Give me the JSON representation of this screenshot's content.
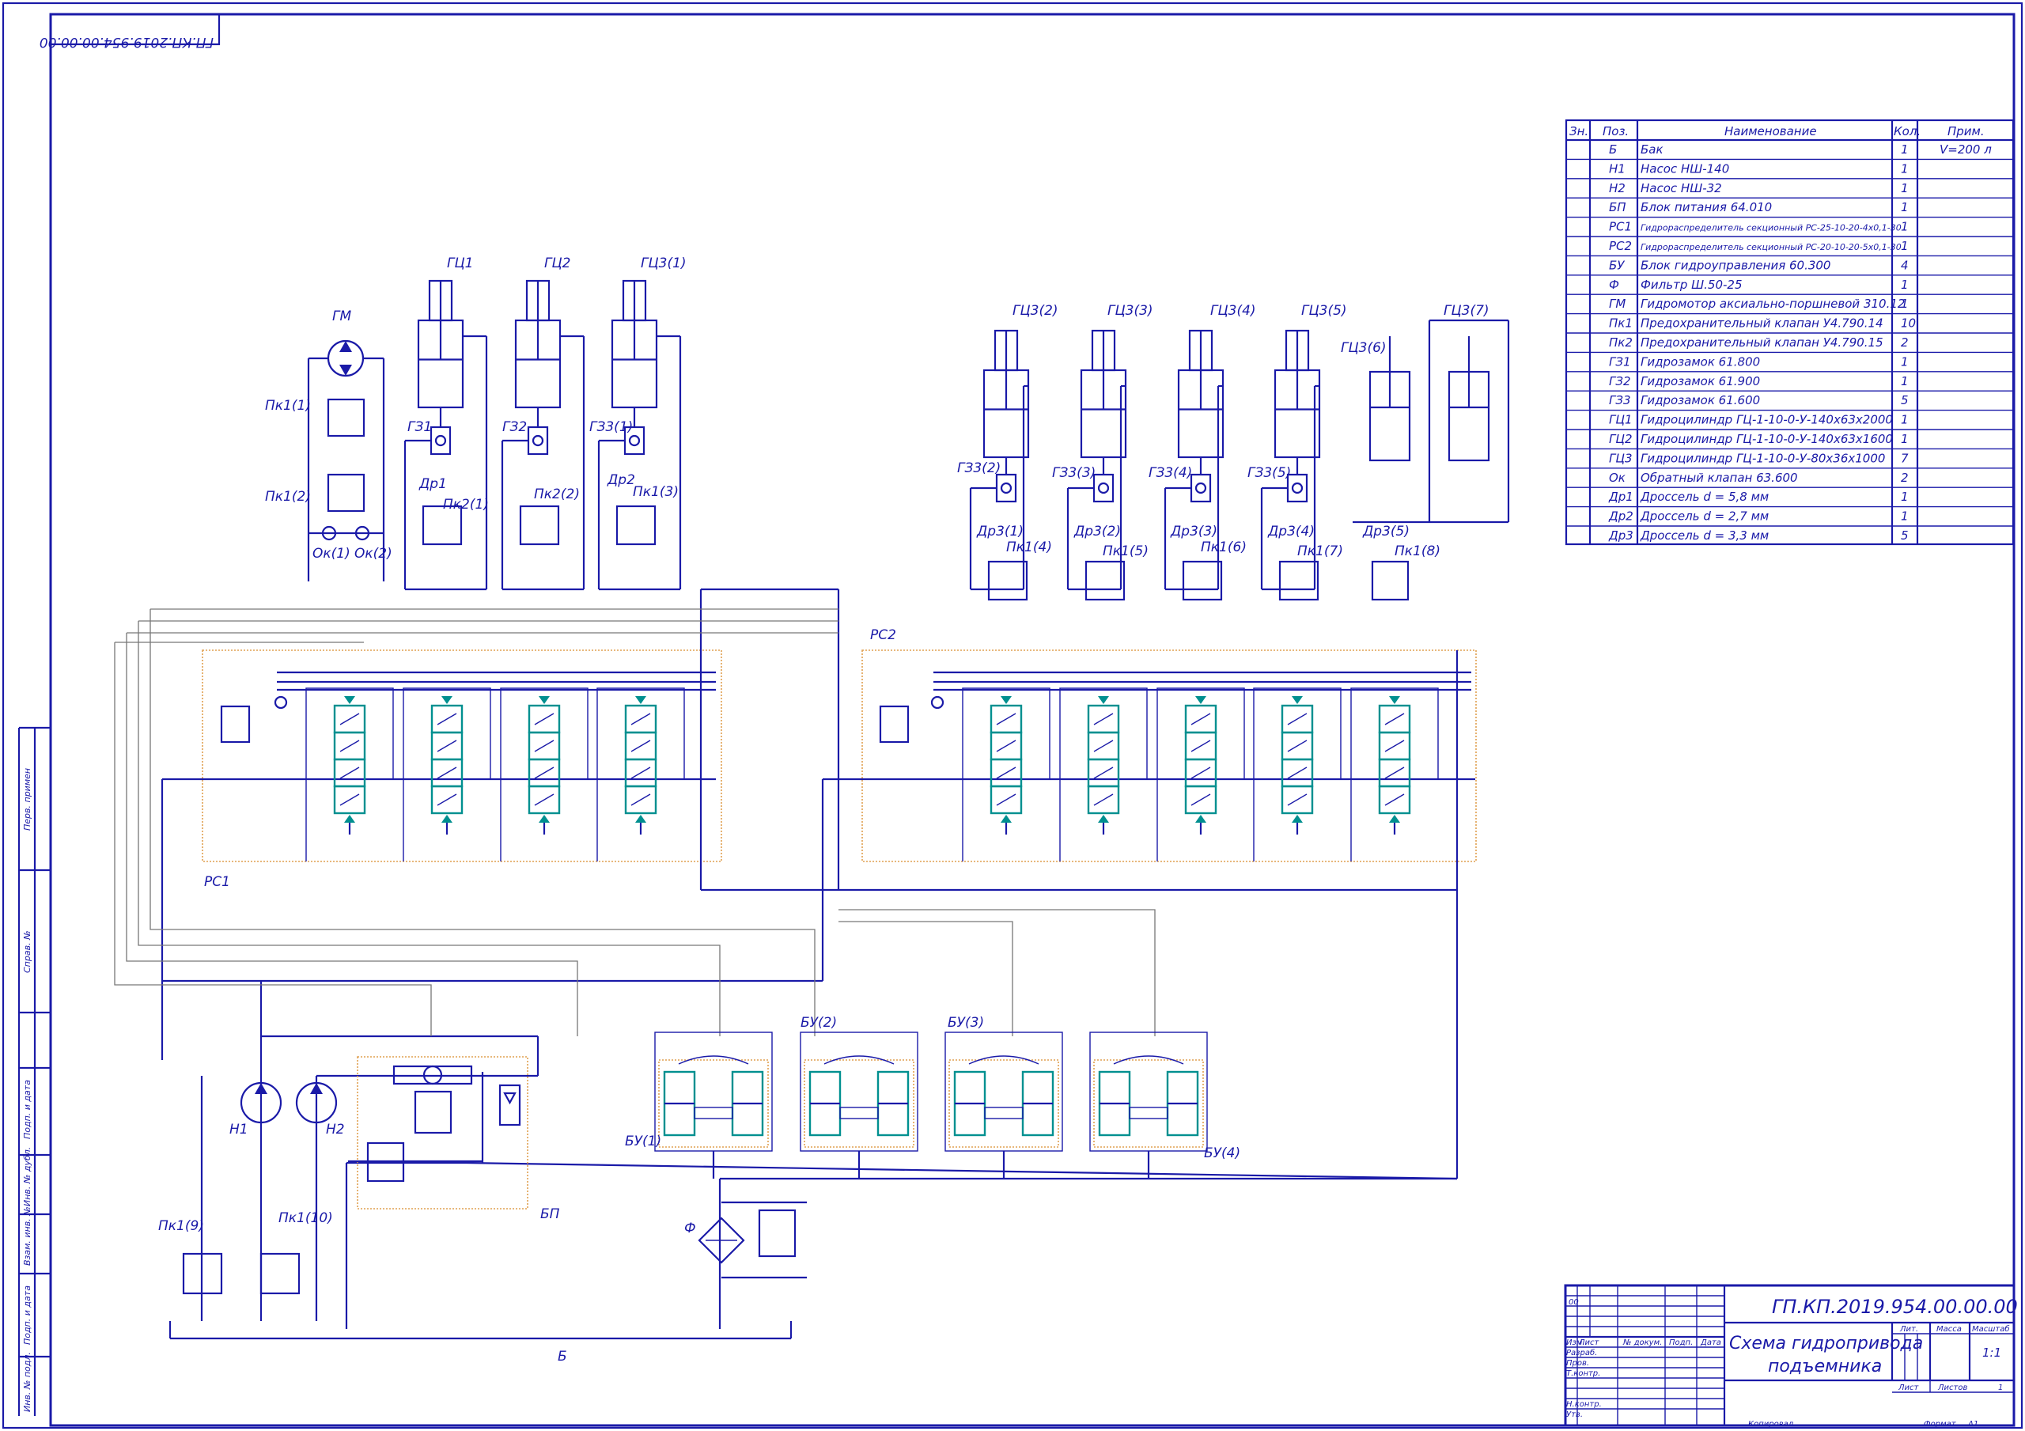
{
  "frame": {
    "rotated_code": "ГП.КП.2019.954.00.00.00",
    "side_labels": [
      "Перв. примен",
      "Справ. №",
      "Подп. и дата",
      "Инв. № дубл.",
      "Взам. инв. №",
      "Подп. и дата",
      "Инв. № подл."
    ]
  },
  "components": {
    "GM": "ГМ",
    "Pk1_1": "Пк1(1)",
    "Pk1_2": "Пк1(2)",
    "Ok1": "Ок(1)",
    "Ok2": "Ок(2)",
    "GC1": "ГЦ1",
    "GC2": "ГЦ2",
    "GC3_1": "ГЦ3(1)",
    "GZ1": "ГЗ1",
    "GZ2": "ГЗ2",
    "GZ3_1": "ГЗ3(1)",
    "Dr1": "Др1",
    "Dr2": "Др2",
    "Pk2_1": "Пк2(1)",
    "Pk2_2": "Пк2(2)",
    "Pk1_3": "Пк1(3)",
    "GC3_2": "ГЦ3(2)",
    "GC3_3": "ГЦ3(3)",
    "GC3_4": "ГЦ3(4)",
    "GC3_5": "ГЦ3(5)",
    "GC3_6": "ГЦ3(6)",
    "GC3_7": "ГЦ3(7)",
    "GZ3_2": "ГЗ3(2)",
    "GZ3_3": "ГЗ3(3)",
    "GZ3_4": "ГЗ3(4)",
    "GZ3_5": "ГЗ3(5)",
    "Dr3_1": "Др3(1)",
    "Dr3_2": "Др3(2)",
    "Dr3_3": "Др3(3)",
    "Dr3_4": "Др3(4)",
    "Dr3_5": "Др3(5)",
    "Pk1_4": "Пк1(4)",
    "Pk1_5": "Пк1(5)",
    "Pk1_6": "Пк1(6)",
    "Pk1_7": "Пк1(7)",
    "Pk1_8": "Пк1(8)",
    "RS1": "РС1",
    "RS2": "РС2",
    "BU1": "БУ(1)",
    "BU2": "БУ(2)",
    "BU3": "БУ(3)",
    "BU4": "БУ(4)",
    "H1": "Н1",
    "H2": "Н2",
    "BP": "БП",
    "F": "Ф",
    "Pk1_9": "Пк1(9)",
    "Pk1_10": "Пк1(10)",
    "B": "Б"
  },
  "spec": {
    "headers": [
      "Зн.",
      "Поз.",
      "Наименование",
      "Кол.",
      "Прим."
    ],
    "rows": [
      {
        "pos": "Б",
        "name": "Бак",
        "qty": "1",
        "note": "V=200 л"
      },
      {
        "pos": "Н1",
        "name": "Насос НШ-140",
        "qty": "1",
        "note": ""
      },
      {
        "pos": "Н2",
        "name": "Насос НШ-32",
        "qty": "1",
        "note": ""
      },
      {
        "pos": "БП",
        "name": "Блок питания 64.010",
        "qty": "1",
        "note": ""
      },
      {
        "pos": "РС1",
        "name": "Гидрораспределитель секционный РС-25-10-20-4х0,1-30",
        "qty": "1",
        "note": ""
      },
      {
        "pos": "РС2",
        "name": "Гидрораспределитель секционный РС-20-10-20-5х0,1-30",
        "qty": "1",
        "note": ""
      },
      {
        "pos": "БУ",
        "name": "Блок гидроуправления 60.300",
        "qty": "4",
        "note": ""
      },
      {
        "pos": "Ф",
        "name": "Фильтр Ш.50-25",
        "qty": "1",
        "note": ""
      },
      {
        "pos": "ГМ",
        "name": "Гидромотор аксиально-поршневой 310.12",
        "qty": "1",
        "note": ""
      },
      {
        "pos": "Пк1",
        "name": "Предохранительный клапан У4.790.14",
        "qty": "10",
        "note": ""
      },
      {
        "pos": "Пк2",
        "name": "Предохранительный клапан У4.790.15",
        "qty": "2",
        "note": ""
      },
      {
        "pos": "ГЗ1",
        "name": "Гидрозамок 61.800",
        "qty": "1",
        "note": ""
      },
      {
        "pos": "ГЗ2",
        "name": "Гидрозамок 61.900",
        "qty": "1",
        "note": ""
      },
      {
        "pos": "ГЗ3",
        "name": "Гидрозамок 61.600",
        "qty": "5",
        "note": ""
      },
      {
        "pos": "ГЦ1",
        "name": "Гидроцилиндр ГЦ-1-10-0-У-140х63х2000",
        "qty": "1",
        "note": ""
      },
      {
        "pos": "ГЦ2",
        "name": "Гидроцилиндр ГЦ-1-10-0-У-140х63х1600",
        "qty": "1",
        "note": ""
      },
      {
        "pos": "ГЦ3",
        "name": "Гидроцилиндр ГЦ-1-10-0-У-80х36х1000",
        "qty": "7",
        "note": ""
      },
      {
        "pos": "Ок",
        "name": "Обратный клапан 63.600",
        "qty": "2",
        "note": ""
      },
      {
        "pos": "Др1",
        "name": "Дроссель d = 5,8 мм",
        "qty": "1",
        "note": ""
      },
      {
        "pos": "Др2",
        "name": "Дроссель d = 2,7 мм",
        "qty": "1",
        "note": ""
      },
      {
        "pos": "Др3",
        "name": "Дроссель d = 3,3 мм",
        "qty": "5",
        "note": ""
      }
    ]
  },
  "title_block": {
    "code": "ГП.КП.2019.954.00.00.00",
    "title_line1": "Схема гидропривода",
    "title_line2": "подъемника",
    "top_cell": "00",
    "col_headers": [
      "Изм.",
      "Лист",
      "№ докум.",
      "Подп.",
      "Дата"
    ],
    "roles": [
      "Разраб.",
      "Пров.",
      "Т.контр.",
      "",
      "Н.контр.",
      "Утв."
    ],
    "lit_header": "Лит.",
    "mass_header": "Масса",
    "scale_header": "Масштаб",
    "scale_value": "1:1",
    "sheet_label": "Лист",
    "sheets_label": "Листов",
    "sheets_value": "1",
    "copied": "Копировал",
    "format_label": "Формат",
    "format_value": "А1"
  }
}
